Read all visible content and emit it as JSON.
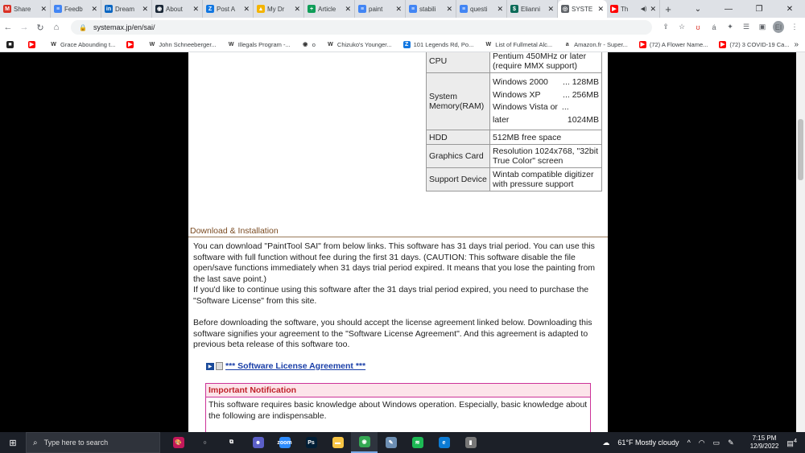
{
  "browser": {
    "tabs": [
      {
        "title": "Share",
        "icon": "gmail-icon",
        "color": "#d93025",
        "glyph": "M"
      },
      {
        "title": "Feedb",
        "icon": "docs-icon",
        "color": "#4285f4",
        "glyph": "≡"
      },
      {
        "title": "Dream",
        "icon": "linkedin-icon",
        "color": "#0a66c2",
        "glyph": "in"
      },
      {
        "title": "About",
        "icon": "steam-icon",
        "color": "#1b2838",
        "glyph": "◉"
      },
      {
        "title": "Post A",
        "icon": "zillow-icon",
        "color": "#1277e1",
        "glyph": "Z"
      },
      {
        "title": "My Dr",
        "icon": "drive-icon",
        "color": "#f4b400",
        "glyph": "▲"
      },
      {
        "title": "Article",
        "icon": "sheets-plus-icon",
        "color": "#0f9d58",
        "glyph": "+"
      },
      {
        "title": "paint",
        "icon": "docs-icon",
        "color": "#4285f4",
        "glyph": "≡"
      },
      {
        "title": "stabili",
        "icon": "docs-icon",
        "color": "#4285f4",
        "glyph": "≡"
      },
      {
        "title": "questi",
        "icon": "docs-icon",
        "color": "#4285f4",
        "glyph": "≡"
      },
      {
        "title": "Elianni",
        "icon": "dollar-icon",
        "color": "#0c6b58",
        "glyph": "$"
      },
      {
        "title": "SYSTE",
        "icon": "globe-icon",
        "color": "#5f6368",
        "glyph": "◎",
        "active": true
      },
      {
        "title": "Th",
        "icon": "youtube-icon",
        "color": "#ff0000",
        "glyph": "▶",
        "audio": "◀)"
      }
    ],
    "new_tab": "+",
    "url": "systemax.jp/en/sai/",
    "bookmarks": [
      {
        "label": "",
        "icon": "bookmark-yellow-icon",
        "color": "#222",
        "glyph": "■"
      },
      {
        "label": "",
        "icon": "youtube-icon",
        "color": "#ff0000",
        "glyph": "▶"
      },
      {
        "label": "Grace Abounding t...",
        "icon": "wikipedia-icon",
        "color": "#fff",
        "glyph": "W"
      },
      {
        "label": "",
        "icon": "youtube-icon",
        "color": "#ff0000",
        "glyph": "▶"
      },
      {
        "label": "John Schneeberger...",
        "icon": "wikipedia-icon",
        "color": "#fff",
        "glyph": "W"
      },
      {
        "label": "Illegals Program -...",
        "icon": "wikipedia-icon",
        "color": "#fff",
        "glyph": "W"
      },
      {
        "label": "o",
        "icon": "globe-icon",
        "color": "#fff",
        "glyph": "◉"
      },
      {
        "label": "Chizuko's Younger...",
        "icon": "wikipedia-icon",
        "color": "#fff",
        "glyph": "W"
      },
      {
        "label": "101 Legends Rd, Po...",
        "icon": "zillow-icon",
        "color": "#1277e1",
        "glyph": "Z"
      },
      {
        "label": "List of Fullmetal Alc...",
        "icon": "wikipedia-icon",
        "color": "#fff",
        "glyph": "W"
      },
      {
        "label": "Amazon.fr - Super...",
        "icon": "amazon-icon",
        "color": "#fff",
        "glyph": "a"
      },
      {
        "label": "(72) A Flower Name...",
        "icon": "youtube-icon",
        "color": "#ff0000",
        "glyph": "▶"
      },
      {
        "label": "(72) 3 COVID-19 Ca...",
        "icon": "youtube-icon",
        "color": "#ff0000",
        "glyph": "▶"
      }
    ],
    "bookmarks_more": "»",
    "profile": "EI"
  },
  "specs": {
    "cpu_label": "CPU",
    "cpu_line1": "Pentium 450MHz or later",
    "cpu_line2": "(require MMX support)",
    "mem_label": "System Memory(RAM)",
    "mem_rows": [
      {
        "os": "Windows 2000",
        "size": "... 128MB"
      },
      {
        "os": "Windows XP",
        "size": "... 256MB"
      },
      {
        "os": "Windows Vista or",
        "size": "..."
      },
      {
        "os": "later",
        "size": "1024MB"
      }
    ],
    "hdd_label": "HDD",
    "hdd_value": "512MB free space",
    "gfx_label": "Graphics Card",
    "gfx_line1": "Resolution 1024x768, \"32bit",
    "gfx_line2": "True Color\" screen",
    "dev_label": "Support Device",
    "dev_line1": "Wintab compatible digitizer",
    "dev_line2": "with pressure support"
  },
  "download": {
    "heading": "Download & Installation",
    "para1": "You can download \"PaintTool SAI\" from below links. This software has 31 days trial period. You can use this software with full function without fee during the first 31 days. (CAUTION: This software disable the file open/save functions immediately when 31 days trial period expired. It means that you lose the painting from the last save point.)",
    "para2": "If you'd like to continue using this software after the 31 days trial period expired, you need to purchase the \"Software License\" from this site.",
    "para3": "Before downloading the software, you should accept the license agreement linked below. Downloading this software signifies your agreement to the \"Software License Agreement\". And this agreement is adapted to previous beta release of this software too.",
    "license_link": "*** Software License Agreement ***",
    "notice_title": "Important Notification",
    "notice_body": "This software requires basic knowledge about Windows operation. Especially, basic knowledge about the following are indispensable."
  },
  "taskbar": {
    "search_placeholder": "Type here to search",
    "apps": [
      {
        "name": "search-highlight-icon",
        "glyph": "🎨",
        "color": "#c2185b"
      },
      {
        "name": "cortana-icon",
        "glyph": "○",
        "color": "transparent"
      },
      {
        "name": "task-view-icon",
        "glyph": "⧉",
        "color": "transparent"
      },
      {
        "name": "teams-icon",
        "glyph": "☻",
        "color": "#5b5fc7"
      },
      {
        "name": "zoom-icon",
        "glyph": "zoom",
        "color": "#2d8cff"
      },
      {
        "name": "photoshop-icon",
        "glyph": "Ps",
        "color": "#001e36"
      },
      {
        "name": "file-explorer-icon",
        "glyph": "▬",
        "color": "#f8c544"
      },
      {
        "name": "chrome-icon",
        "glyph": "◉",
        "color": "#34a853",
        "active": true
      },
      {
        "name": "notepad-icon",
        "glyph": "✎",
        "color": "#6d8fb3"
      },
      {
        "name": "spotify-icon",
        "glyph": "≋",
        "color": "#1db954"
      },
      {
        "name": "edge-icon",
        "glyph": "e",
        "color": "#0c7bd4"
      },
      {
        "name": "usb-icon",
        "glyph": "▮",
        "color": "#777"
      }
    ],
    "weather": "61°F  Mostly cloudy",
    "time": "7:15 PM",
    "date": "12/9/2022",
    "notifications": "4"
  }
}
